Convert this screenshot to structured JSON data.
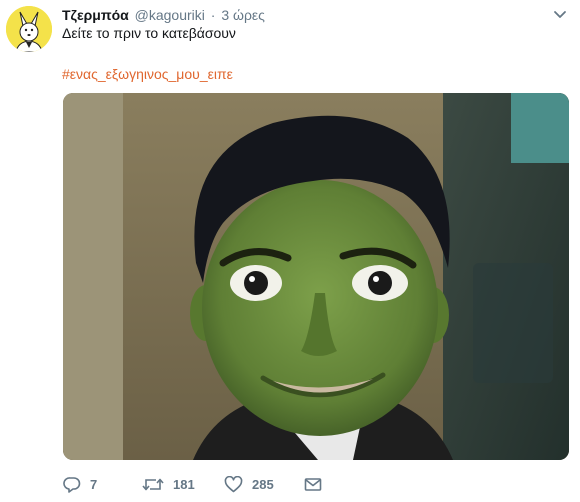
{
  "tweet": {
    "display_name": "Τζερμπόα",
    "handle": "@kagouriki",
    "separator": "·",
    "timestamp": "3 ώρες",
    "text": "Δείτε το πριν το κατεβάσουν",
    "hashtag": "#ενας_εξωγηινος_μου_ειπε"
  },
  "media": {
    "description_icon": "photo"
  },
  "actions": {
    "reply_count": "7",
    "retweet_count": "181",
    "like_count": "285"
  },
  "icons": {
    "caret": "chevron-down-icon",
    "reply": "reply-icon",
    "retweet": "retweet-icon",
    "like": "heart-icon",
    "dm": "envelope-icon"
  },
  "colors": {
    "hashtag": "#e0672f",
    "secondary_text": "#657786",
    "primary_text": "#14171a",
    "avatar_bg": "#f4e24a"
  }
}
